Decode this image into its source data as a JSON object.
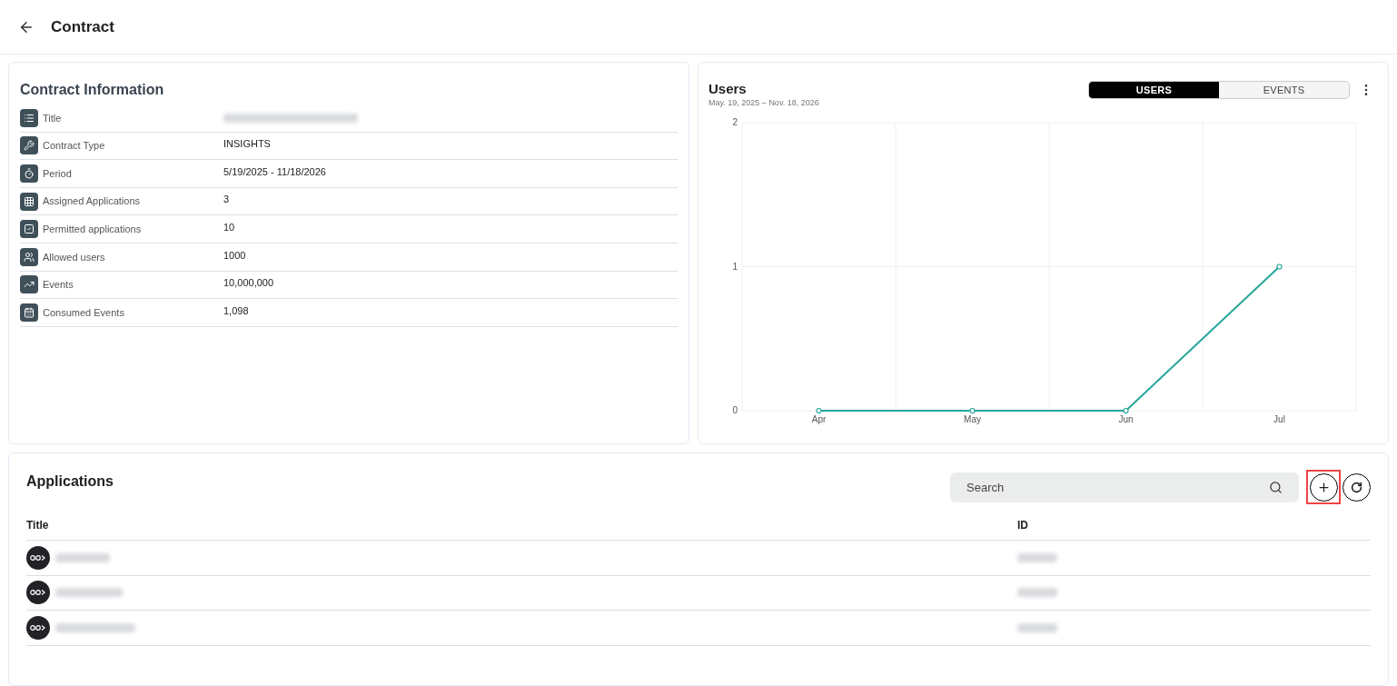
{
  "header": {
    "title": "Contract"
  },
  "contract_info": {
    "title": "Contract Information",
    "rows": [
      {
        "label": "Title",
        "blurred": true
      },
      {
        "label": "Contract Type",
        "value": "INSIGHTS",
        "blurred": false
      },
      {
        "label": "Period",
        "value": "5/19/2025 - 11/18/2026",
        "blurred": false
      },
      {
        "label": "Assigned Applications",
        "value": "3",
        "blurred": false
      },
      {
        "label": "Permitted applications",
        "value": "10",
        "blurred": false
      },
      {
        "label": "Allowed users",
        "value": "1000",
        "blurred": false
      },
      {
        "label": "Events",
        "value": "10,000,000",
        "blurred": false
      },
      {
        "label": "Consumed Events",
        "value": "1,098",
        "blurred": false
      }
    ]
  },
  "users_chart": {
    "title": "Users",
    "subtitle": "May. 19, 2025 – Nov. 18, 2026",
    "toggle": [
      {
        "label": "USERS",
        "selected": true
      },
      {
        "label": "EVENTS",
        "selected": false
      }
    ],
    "chart_data": {
      "type": "line",
      "categories": [
        "Apr",
        "May",
        "Jun",
        "Jul"
      ],
      "series": [
        {
          "color": "#26a69a",
          "marker": true,
          "values": [
            0,
            0,
            0,
            1
          ]
        }
      ],
      "ylim": [
        0,
        2
      ],
      "yticks": [
        0,
        1,
        2
      ]
    }
  },
  "applications": {
    "title": "Applications",
    "search": {
      "placeholder": "Search"
    },
    "add_button": {
      "highlighted": true
    },
    "columns": [
      "Title",
      "ID"
    ],
    "rows": [
      {
        "blurred": true
      },
      {
        "blurred": true
      },
      {
        "blurred": true
      }
    ]
  }
}
